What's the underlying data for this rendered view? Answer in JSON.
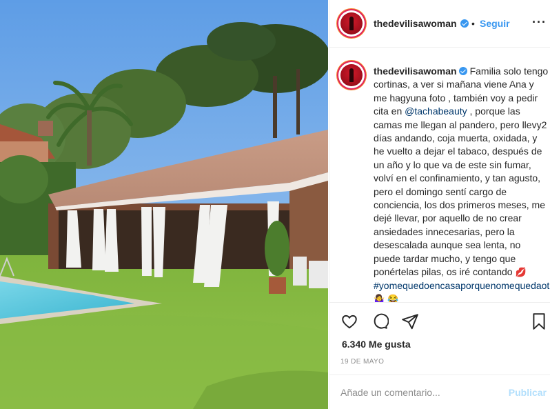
{
  "post": {
    "username": "thedevilisawoman",
    "verified_icon": "verified-badge-icon",
    "separator": "•",
    "follow_label": "Seguir",
    "more_label": "···"
  },
  "caption": {
    "username": "thedevilisawoman",
    "text_1": "Familia solo tengo cortinas, a ver si mañana viene Ana y me hagyuna foto , también voy a pedir cita en ",
    "mention": "@tachabeauty",
    "text_2": " , porque las camas me llegan al pandero, pero llevy2 días andando, coja muerta, oxidada, y he vuelto a dejar el tabaco, después de un año y lo que va de este sin fumar, volví en el confinamiento, y tan agusto, pero el domingo sentí cargo de conciencia, los dos primeros meses, me dejé llevar, por aquello de no crear ansiedades innecesarias, pero la desescalada aunque sea lenta, no puede tardar mucho, y tengo que ponértelas pilas, os iré contando ",
    "emoji_1": "💋",
    "hashtag": "#yomequedoencasaporquenomequedaotra",
    "emoji_2": "🤷‍♀️",
    "emoji_3": "😂"
  },
  "actions": {
    "like_icon": "heart-icon",
    "comment_icon": "comment-icon",
    "share_icon": "paper-plane-icon",
    "save_icon": "bookmark-icon",
    "likes_text": "6.340 Me gusta",
    "date_text": "19 DE MAYO"
  },
  "comment": {
    "placeholder": "Añade un comentario...",
    "publish_label": "Publicar"
  },
  "colors": {
    "link_blue": "#3897f0",
    "mention_blue": "#00376b",
    "publish_disabled": "#b2dffc",
    "muted": "#8e8e8e"
  }
}
